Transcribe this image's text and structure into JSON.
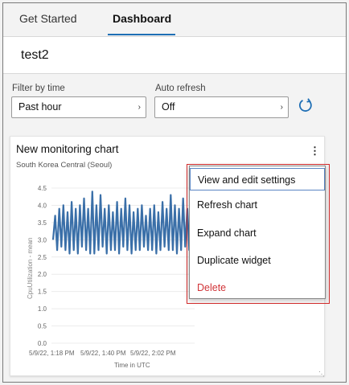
{
  "tabs": [
    {
      "label": "Get Started"
    },
    {
      "label": "Dashboard"
    }
  ],
  "dashboard": {
    "name": "test2"
  },
  "filters": {
    "time_label": "Filter by time",
    "time_value": "Past hour",
    "refresh_label": "Auto refresh",
    "refresh_value": "Off"
  },
  "widget": {
    "title": "New monitoring chart",
    "subtitle": "South Korea Central (Seoul)",
    "menu_icon": "more-vertical-icon"
  },
  "menu": {
    "items": [
      {
        "label": "View and edit settings"
      },
      {
        "label": "Refresh chart"
      },
      {
        "label": "Expand chart"
      },
      {
        "label": "Duplicate widget"
      },
      {
        "label": "Delete"
      }
    ]
  },
  "colors": {
    "accent": "#1f6fb5",
    "series": "#3a6fa8",
    "delete": "#d13438"
  },
  "chart_data": {
    "type": "line",
    "ylabel": "CpuUtilization - mean",
    "xlabel": "Time in UTC",
    "ylim": [
      0,
      4.5
    ],
    "yticks": [
      "0.0",
      "0.5",
      "1.0",
      "1.5",
      "2.0",
      "2.5",
      "3.0",
      "3.5",
      "4.0",
      "4.5"
    ],
    "xticks": [
      "5/9/22, 1:18 PM",
      "5/9/22, 1:40 PM",
      "5/9/22, 2:02 PM"
    ],
    "values": [
      3.0,
      3.7,
      2.7,
      3.9,
      2.8,
      4.0,
      2.7,
      3.8,
      2.6,
      4.1,
      2.7,
      3.9,
      2.6,
      4.0,
      2.8,
      4.2,
      2.7,
      3.9,
      2.6,
      4.4,
      2.6,
      4.0,
      2.7,
      4.3,
      2.8,
      3.9,
      2.6,
      4.0,
      2.7,
      3.8,
      2.7,
      4.1,
      2.6,
      3.9,
      2.8,
      4.2,
      2.7,
      4.0,
      2.6,
      3.8,
      2.7,
      3.9,
      2.7,
      4.0,
      2.8,
      3.7,
      2.7,
      3.9,
      2.7,
      4.0,
      2.6,
      3.8,
      2.7,
      4.1,
      2.8,
      3.9,
      2.7,
      4.3,
      2.7,
      4.0,
      2.6,
      3.9,
      2.7,
      4.2,
      2.8,
      3.9,
      2.7,
      3.6
    ]
  }
}
